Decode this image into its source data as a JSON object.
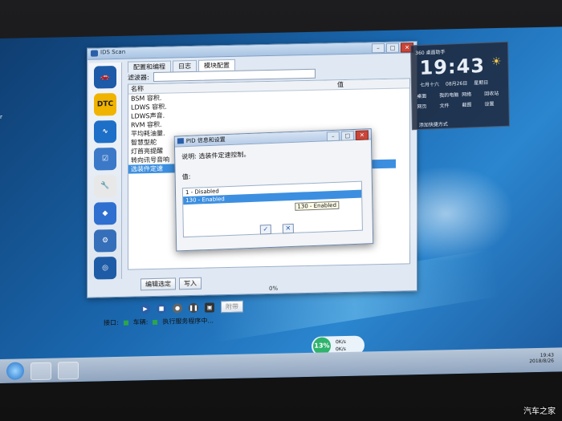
{
  "app": {
    "title": "IDS Scan",
    "tabs": [
      "配置和编程",
      "日志",
      "模块配置"
    ],
    "filter_label": "滤波器:",
    "list_header": [
      "名称",
      "值"
    ],
    "list_items": [
      "BSM 容积.",
      "LDWS 容积.",
      "LDWS声音.",
      "RVM 容积.",
      "平均耗油量.",
      "智慧型舵",
      "灯首亮提醒",
      "转向讯号音响",
      "选装件定速"
    ],
    "selected_index": 8,
    "edit_button": "编辑选定",
    "write_button": "写入",
    "progress": "0%",
    "toolbar_dropdown": "附带",
    "status_port": "接口:",
    "status_vehicle": "车辆:",
    "status_message": "执行服务程序中..."
  },
  "dialog": {
    "title": "PID 信息和设置",
    "description": "说明: 选装件定速控制。",
    "value_label": "值:",
    "options": [
      "1 - Disabled",
      "130 - Enabled"
    ],
    "selected_index": 1,
    "tooltip": "130 - Enabled",
    "ok_label": "✓",
    "cancel_label": "✕"
  },
  "widget": {
    "brand": "360 桌面助手",
    "time": "19:43",
    "date_lunar": "七月十六",
    "date": "08月26日",
    "weekday": "星期日",
    "icons": [
      "桌面",
      "我的电脑",
      "网络",
      "回收站",
      "网页",
      "文件",
      "截图",
      "设置"
    ],
    "add_label": "添加快捷方式"
  },
  "speedball": {
    "percent": "13%",
    "up": "0K/s",
    "down": "0K/s"
  },
  "tray": {
    "time": "19:43",
    "date": "2018/8/26"
  },
  "desktop_text": "r",
  "watermark": "汽车之家"
}
